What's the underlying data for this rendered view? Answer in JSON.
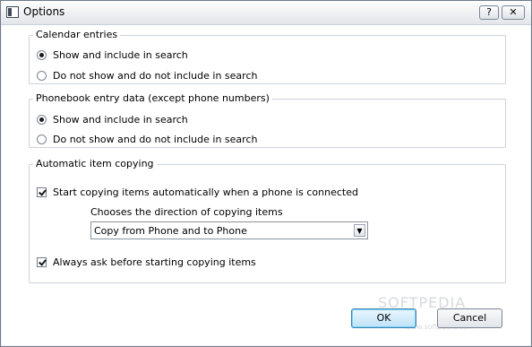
{
  "window": {
    "title": "Options",
    "help_label": "?",
    "close_label": "✕"
  },
  "calendar": {
    "legend": "Calendar entries",
    "options": [
      {
        "label": "Show and include in search",
        "selected": true
      },
      {
        "label": "Do not show and do not include in search",
        "selected": false
      }
    ]
  },
  "phonebook": {
    "legend": "Phonebook entry data (except phone numbers)",
    "options": [
      {
        "label": "Show and include in search",
        "selected": true
      },
      {
        "label": "Do not show and do not include in search",
        "selected": false
      }
    ]
  },
  "copying": {
    "legend": "Automatic item copying",
    "auto_copy_label": "Start copying items automatically when a phone is connected",
    "auto_copy_checked": true,
    "direction_label": "Chooses the direction of copying items",
    "direction_value": "Copy from Phone and to Phone",
    "always_ask_label": "Always ask before starting copying items",
    "always_ask_checked": true
  },
  "buttons": {
    "ok_label": "OK",
    "cancel_label": "Cancel"
  },
  "watermark": {
    "text": "SOFTPEDIA",
    "sub": "www.softpedia.com"
  }
}
